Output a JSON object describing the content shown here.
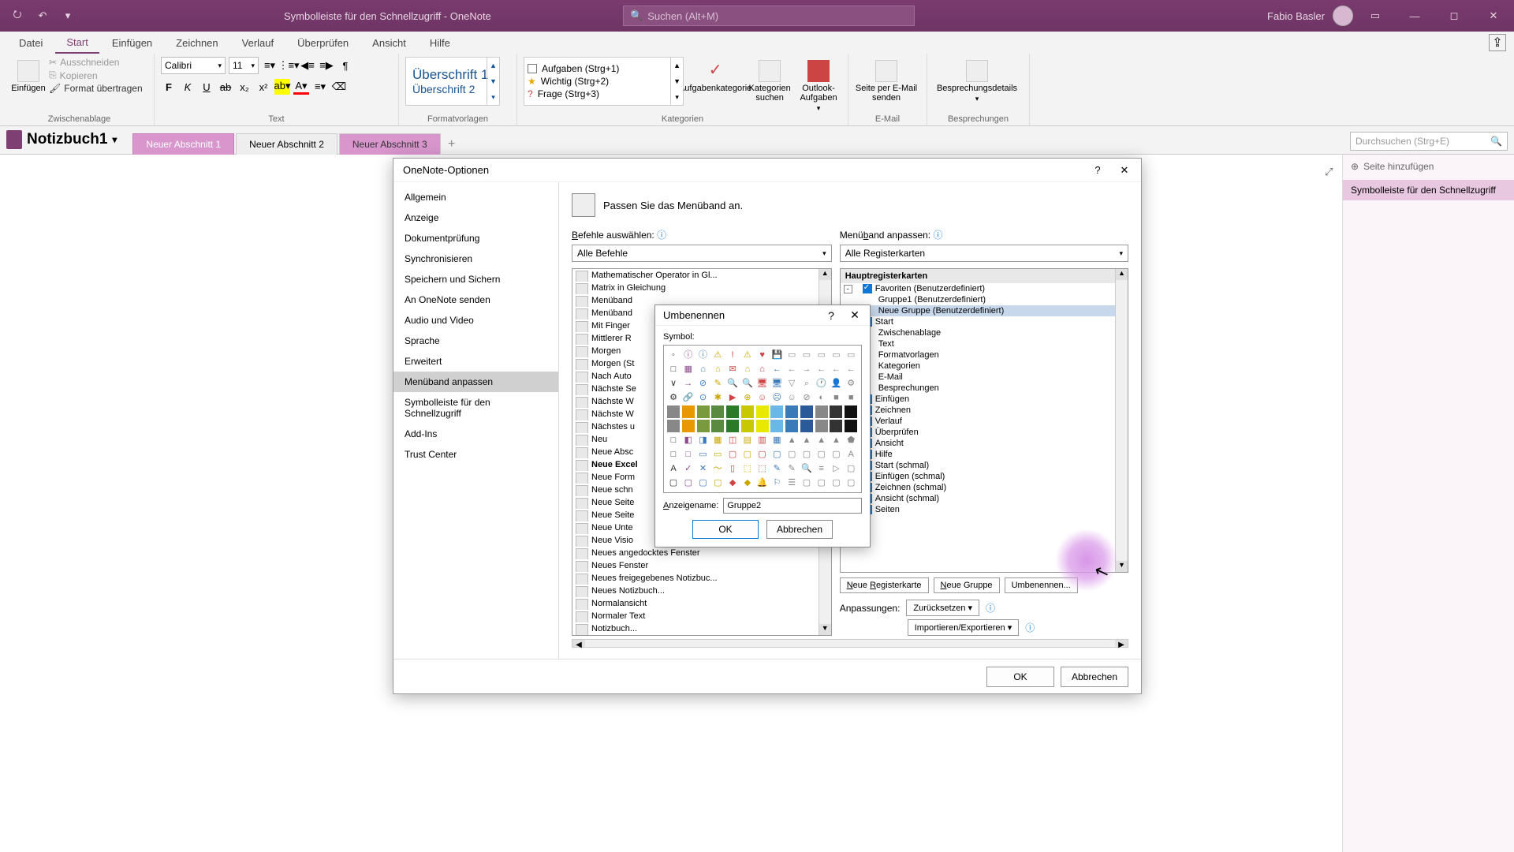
{
  "titlebar": {
    "title": "Symbolleiste für den Schnellzugriff  -  OneNote",
    "search_placeholder": "Suchen (Alt+M)",
    "username": "Fabio Basler"
  },
  "ribbon_tabs": [
    "Datei",
    "Start",
    "Einfügen",
    "Zeichnen",
    "Verlauf",
    "Überprüfen",
    "Ansicht",
    "Hilfe"
  ],
  "ribbon_active_tab": "Start",
  "ribbon": {
    "clipboard": {
      "label": "Zwischenablage",
      "paste": "Einfügen",
      "cut": "Ausschneiden",
      "copy": "Kopieren",
      "format": "Format übertragen"
    },
    "font": {
      "label": "Text",
      "font": "Calibri",
      "size": "11"
    },
    "styles": {
      "label": "Formatvorlagen",
      "h1": "Überschrift 1",
      "h2": "Überschrift 2"
    },
    "tags": {
      "label": "Kategorien",
      "t1": "Aufgaben (Strg+1)",
      "t2": "Wichtig (Strg+2)",
      "t3": "Frage (Strg+3)",
      "find": "Aufgabenkategorie",
      "search": "Kategorien suchen",
      "outlook": "Outlook-Aufgaben"
    },
    "email": {
      "label": "E-Mail",
      "btn": "Seite per E-Mail senden"
    },
    "meeting": {
      "label": "Besprechungen",
      "btn": "Besprechungsdetails"
    }
  },
  "notebook": {
    "title": "Notizbuch1",
    "sections": [
      "Neuer Abschnitt 1",
      "Neuer Abschnitt 2",
      "Neuer Abschnitt 3"
    ],
    "search": "Durchsuchen (Strg+E)",
    "add_page": "Seite hinzufügen",
    "page1": "Symbolleiste für den Schnellzugriff"
  },
  "options": {
    "title": "OneNote-Optionen",
    "nav": [
      "Allgemein",
      "Anzeige",
      "Dokumentprüfung",
      "Synchronisieren",
      "Speichern und Sichern",
      "An OneNote senden",
      "Audio und Video",
      "Sprache",
      "Erweitert",
      "Menüband anpassen",
      "Symbolleiste für den Schnellzugriff",
      "Add-Ins",
      "Trust Center"
    ],
    "nav_selected": "Menüband anpassen",
    "header": "Passen Sie das Menüband an.",
    "left_label": "Befehle auswählen:",
    "left_select": "Alle Befehle",
    "right_label": "Menüband anpassen:",
    "right_select": "Alle Registerkarten",
    "commands": [
      "Mathematischer Operator in Gl...",
      "Matrix in Gleichung",
      "Menüband",
      "Menüband",
      "Mit Finger",
      "Mittlerer R",
      "Morgen",
      "Morgen (St",
      "Nach Auto",
      "Nächste Se",
      "Nächste W",
      "Nächste W",
      "Nächstes u",
      "Neu",
      "Neue Absc",
      "Neue Excel",
      "Neue Form",
      "Neue schn",
      "Neue Seite",
      "Neue Seite",
      "Neue Unte",
      "Neue Visio",
      "Neues angedocktes Fenster",
      "Neues Fenster",
      "Neues freigegebenes Notizbuc...",
      "Neues Notizbuch...",
      "Normalansicht",
      "Normaler Text",
      "Notizbuch..."
    ],
    "command_bold": "Neue Excel",
    "tree_header": "Hauptregisterkarten",
    "tree": [
      {
        "label": "Favoriten (Benutzerdefiniert)",
        "lvl": 0,
        "chk": true,
        "exp": "-"
      },
      {
        "label": "Gruppe1 (Benutzerdefiniert)",
        "lvl": 1
      },
      {
        "label": "Neue Gruppe (Benutzerdefiniert)",
        "lvl": 1,
        "sel": true
      },
      {
        "label": "Start",
        "lvl": 0,
        "chk": true,
        "exp": "-"
      },
      {
        "label": "Zwischenablage",
        "lvl": 1,
        "exp": "+"
      },
      {
        "label": "Text",
        "lvl": 1,
        "exp": "+"
      },
      {
        "label": "Formatvorlagen",
        "lvl": 1,
        "exp": "+"
      },
      {
        "label": "Kategorien",
        "lvl": 1,
        "exp": "+"
      },
      {
        "label": "E-Mail",
        "lvl": 1,
        "exp": "+"
      },
      {
        "label": "Besprechungen",
        "lvl": 1,
        "exp": "+"
      },
      {
        "label": "Einfügen",
        "lvl": 0,
        "chk": true,
        "exp": "+"
      },
      {
        "label": "Zeichnen",
        "lvl": 0,
        "chk": true,
        "exp": "+"
      },
      {
        "label": "Verlauf",
        "lvl": 0,
        "chk": true,
        "exp": "+"
      },
      {
        "label": "Überprüfen",
        "lvl": 0,
        "chk": true,
        "exp": "+"
      },
      {
        "label": "Ansicht",
        "lvl": 0,
        "chk": true,
        "exp": "+"
      },
      {
        "label": "Hilfe",
        "lvl": 0,
        "chk": true,
        "exp": "+"
      },
      {
        "label": "Start (schmal)",
        "lvl": 0,
        "chk": true,
        "exp": "+"
      },
      {
        "label": "Einfügen (schmal)",
        "lvl": 0,
        "chk": true,
        "exp": "+"
      },
      {
        "label": "Zeichnen (schmal)",
        "lvl": 0,
        "chk": true,
        "exp": "+"
      },
      {
        "label": "Ansicht (schmal)",
        "lvl": 0,
        "chk": true,
        "exp": "+"
      },
      {
        "label": "Seiten",
        "lvl": 0,
        "chk": true,
        "exp": "+"
      }
    ],
    "btn_newtab": "Neue Registerkarte",
    "btn_newgroup": "Neue Gruppe",
    "btn_rename": "Umbenennen...",
    "adjust_label": "Anpassungen:",
    "reset": "Zurücksetzen",
    "impexp": "Importieren/Exportieren",
    "ok": "OK",
    "cancel": "Abbrechen"
  },
  "rename": {
    "title": "Umbenennen",
    "symbol_label": "Symbol:",
    "name_label": "Anzeigename:",
    "name_value": "Gruppe2",
    "ok": "OK",
    "cancel": "Abbrechen"
  }
}
